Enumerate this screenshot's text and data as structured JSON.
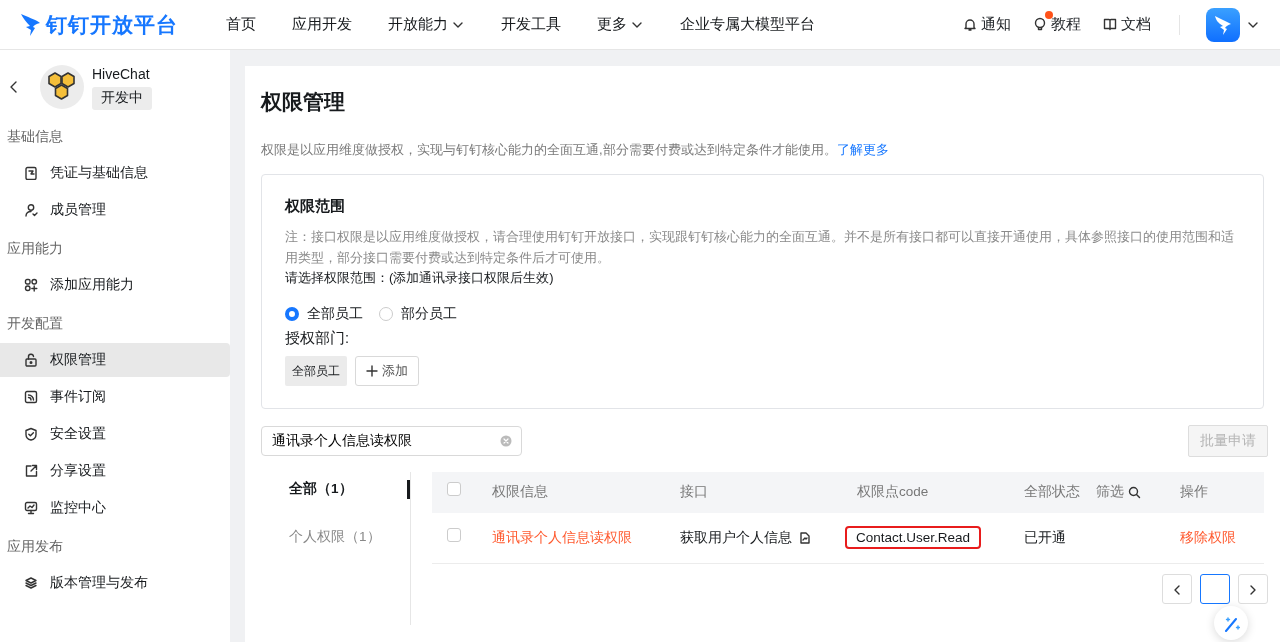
{
  "brand": "钉钉开放平台",
  "nav": [
    {
      "label": "首页",
      "dropdown": false
    },
    {
      "label": "应用开发",
      "dropdown": false
    },
    {
      "label": "开放能力",
      "dropdown": true
    },
    {
      "label": "开发工具",
      "dropdown": false
    },
    {
      "label": "更多",
      "dropdown": true
    },
    {
      "label": "企业专属大模型平台",
      "dropdown": false
    }
  ],
  "header_links": [
    {
      "label": "通知",
      "kind": "bell",
      "dot": false
    },
    {
      "label": "教程",
      "kind": "bulb",
      "dot": true
    },
    {
      "label": "文档",
      "kind": "book",
      "dot": false
    }
  ],
  "app": {
    "name": "HiveChat",
    "status": "开发中"
  },
  "sidebar": [
    {
      "group": "基础信息",
      "items": [
        {
          "label": "凭证与基础信息",
          "kind": "doc",
          "selected": false
        },
        {
          "label": "成员管理",
          "kind": "user",
          "selected": false
        }
      ]
    },
    {
      "group": "应用能力",
      "items": [
        {
          "label": "添加应用能力",
          "kind": "grid",
          "selected": false
        }
      ]
    },
    {
      "group": "开发配置",
      "items": [
        {
          "label": "权限管理",
          "kind": "lock",
          "selected": true
        },
        {
          "label": "事件订阅",
          "kind": "rss",
          "selected": false
        },
        {
          "label": "安全设置",
          "kind": "shield",
          "selected": false
        },
        {
          "label": "分享设置",
          "kind": "share",
          "selected": false
        },
        {
          "label": "监控中心",
          "kind": "monitor",
          "selected": false
        }
      ]
    },
    {
      "group": "应用发布",
      "items": [
        {
          "label": "版本管理与发布",
          "kind": "layers",
          "selected": false
        }
      ]
    }
  ],
  "page": {
    "title": "权限管理",
    "description": "权限是以应用维度做授权，实现与钉钉核心能力的全面互通,部分需要付费或达到特定条件才能使用。",
    "learn_more": "了解更多"
  },
  "scope_card": {
    "title": "权限范围",
    "note": "注：接口权限是以应用维度做授权，请合理使用钉钉开放接口，实现跟钉钉核心能力的全面互通。并不是所有接口都可以直接开通使用，具体参照接口的使用范围和适用类型，部分接口需要付费或达到特定条件后才可使用。",
    "prompt": "请选择权限范围：(添加通讯录接口权限后生效)",
    "options": [
      {
        "label": "全部员工",
        "selected": true
      },
      {
        "label": "部分员工",
        "selected": false
      }
    ],
    "dept_label": "授权部门:",
    "dept_tags": [
      "全部员工"
    ],
    "add_button": "添加"
  },
  "search": {
    "value": "通讯录个人信息读权限"
  },
  "batch_button": {
    "label": "批量申请",
    "disabled": true
  },
  "filter_tabs": [
    {
      "label": "全部（1）",
      "selected": true
    },
    {
      "label": "个人权限（1）",
      "selected": false
    }
  ],
  "table": {
    "header_checked": false,
    "columns": [
      "权限信息",
      "接口",
      "权限点code",
      "全部状态"
    ],
    "filter_label": "筛选",
    "action_column": "操作",
    "rows": [
      {
        "checked": false,
        "name": "通讯录个人信息读权限",
        "api": "获取用户个人信息",
        "code": "Contact.User.Read",
        "code_highlighted": true,
        "status": "已开通",
        "action": "移除权限"
      }
    ]
  }
}
